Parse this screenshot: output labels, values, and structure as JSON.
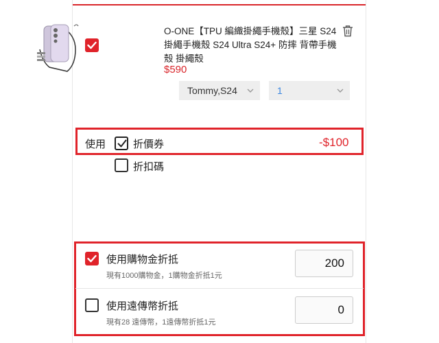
{
  "cart_item": {
    "title": "O-ONE【TPU 編織掛繩手機殼】三星 S24 掛繩手機殼 S24 Ultra S24+ 防摔 背帶手機殼 掛繩殼",
    "price": "$590",
    "variant_selected": "Tommy,S24",
    "quantity_selected": "1",
    "checked": true,
    "icons": {
      "checkbox": "check-icon",
      "delete": "trash-icon",
      "dropdown": "chevron-down-icon"
    }
  },
  "discount": {
    "use_label": "使用",
    "coupon_label": "折價券",
    "coupon_checked": true,
    "coupon_amount": "-$100",
    "code_label": "折扣碼",
    "code_checked": false
  },
  "points": {
    "shopping_credit": {
      "label": "使用購物金折抵",
      "checked": true,
      "note": "現有1000購物金，1購物金折抵1元",
      "value": "200"
    },
    "coins": {
      "label": "使用遠傳幣折抵",
      "checked": false,
      "note": "現有28 遠傳幣，1遠傳幣折抵1元",
      "value": "0"
    }
  },
  "colors": {
    "accent_red": "#e0232a",
    "price_red": "#d9252a",
    "quantity_blue": "#3a86e0"
  }
}
